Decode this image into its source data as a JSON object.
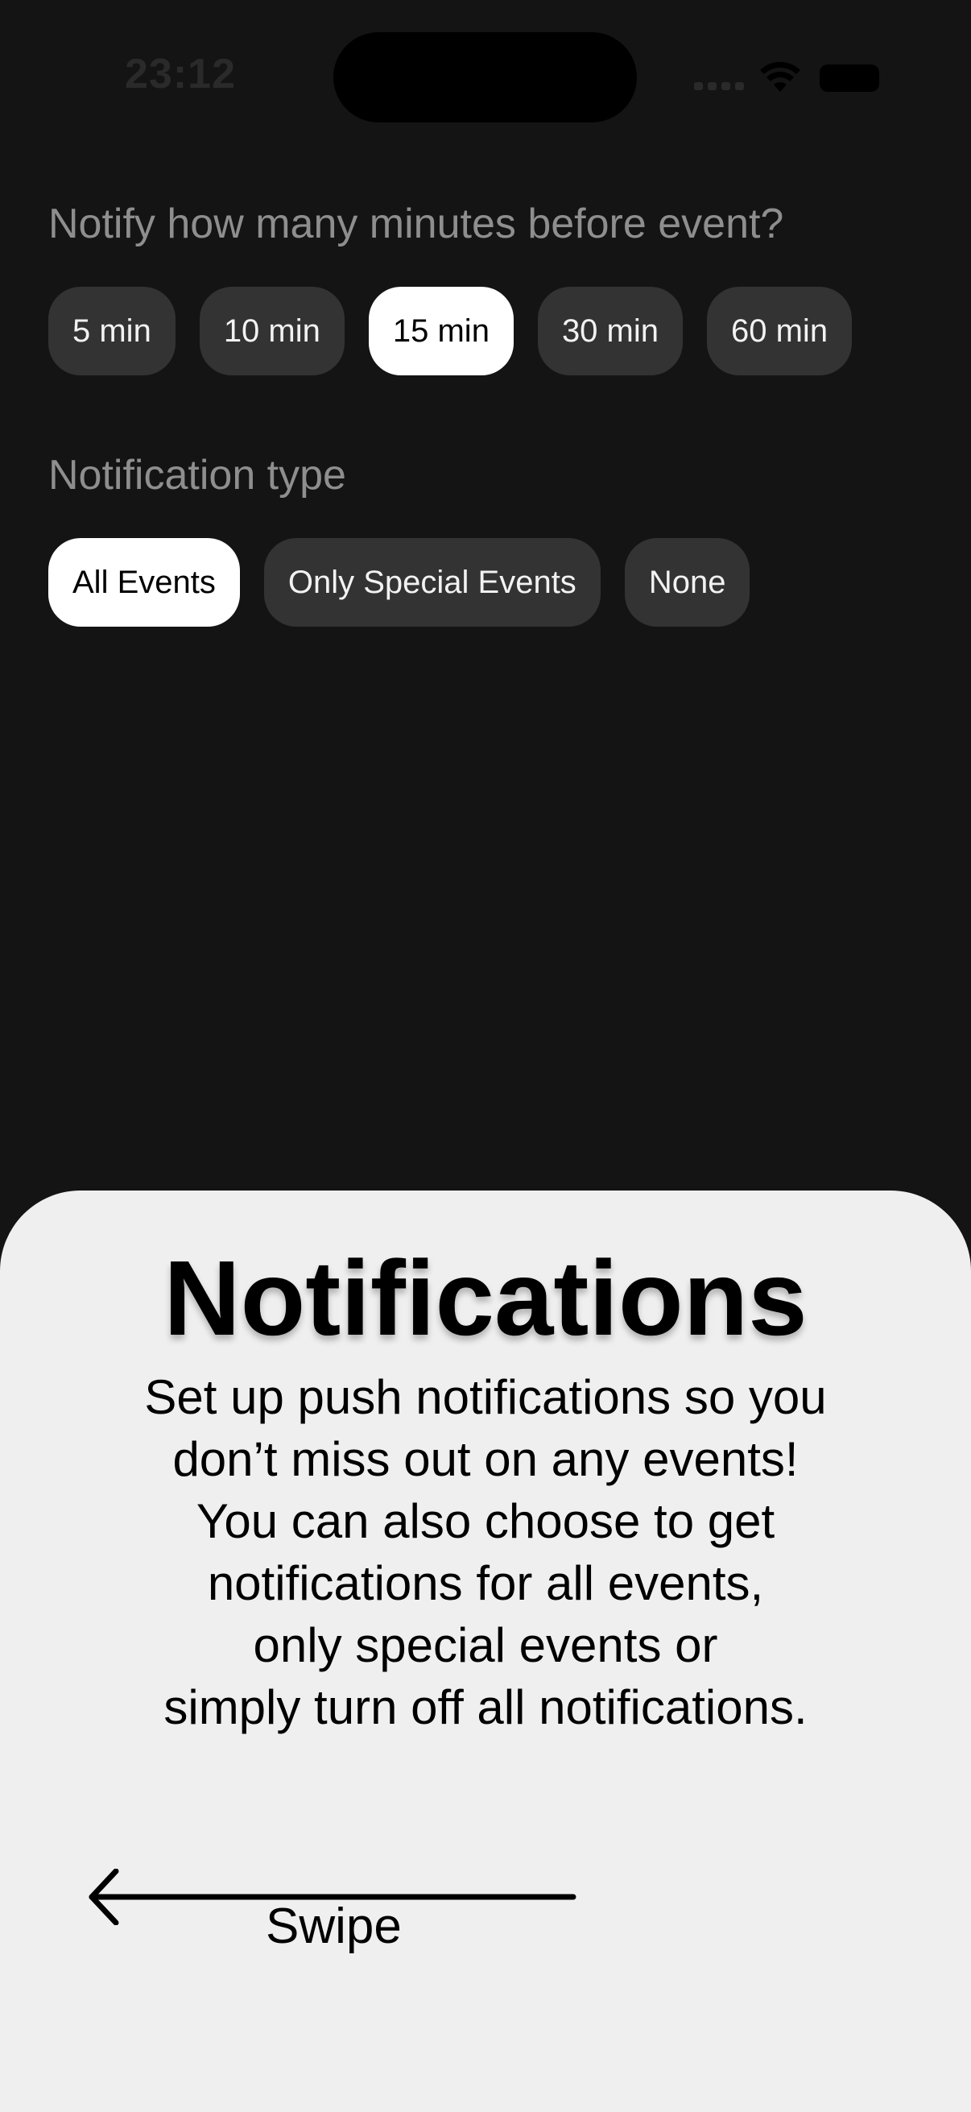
{
  "status_bar": {
    "time": "23:12",
    "icons": [
      "signal-icon",
      "wifi-icon",
      "battery-icon"
    ]
  },
  "settings": {
    "minutes_label": "Notify how many minutes before event?",
    "minutes_options": [
      "5 min",
      "10 min",
      "15 min",
      "30 min",
      "60 min"
    ],
    "minutes_selected": "15 min",
    "type_label": "Notification type",
    "type_options": [
      "All Events",
      "Only Special Events",
      "None"
    ],
    "type_selected": "All Events"
  },
  "sheet": {
    "title": "Notifications",
    "body_lines": [
      "Set up push notifications so you",
      "don’t miss out on any events!",
      "You can also choose to get",
      "notifications for all events,",
      "only special events or",
      "simply turn off all notifications."
    ],
    "swipe_label": "Swipe",
    "swipe_icon": "arrow-left-icon"
  },
  "colors": {
    "background": "#141414",
    "chip": "#333333",
    "chip_selected": "#ffffff",
    "label": "#8e8e8e",
    "sheet": "#efefef"
  }
}
